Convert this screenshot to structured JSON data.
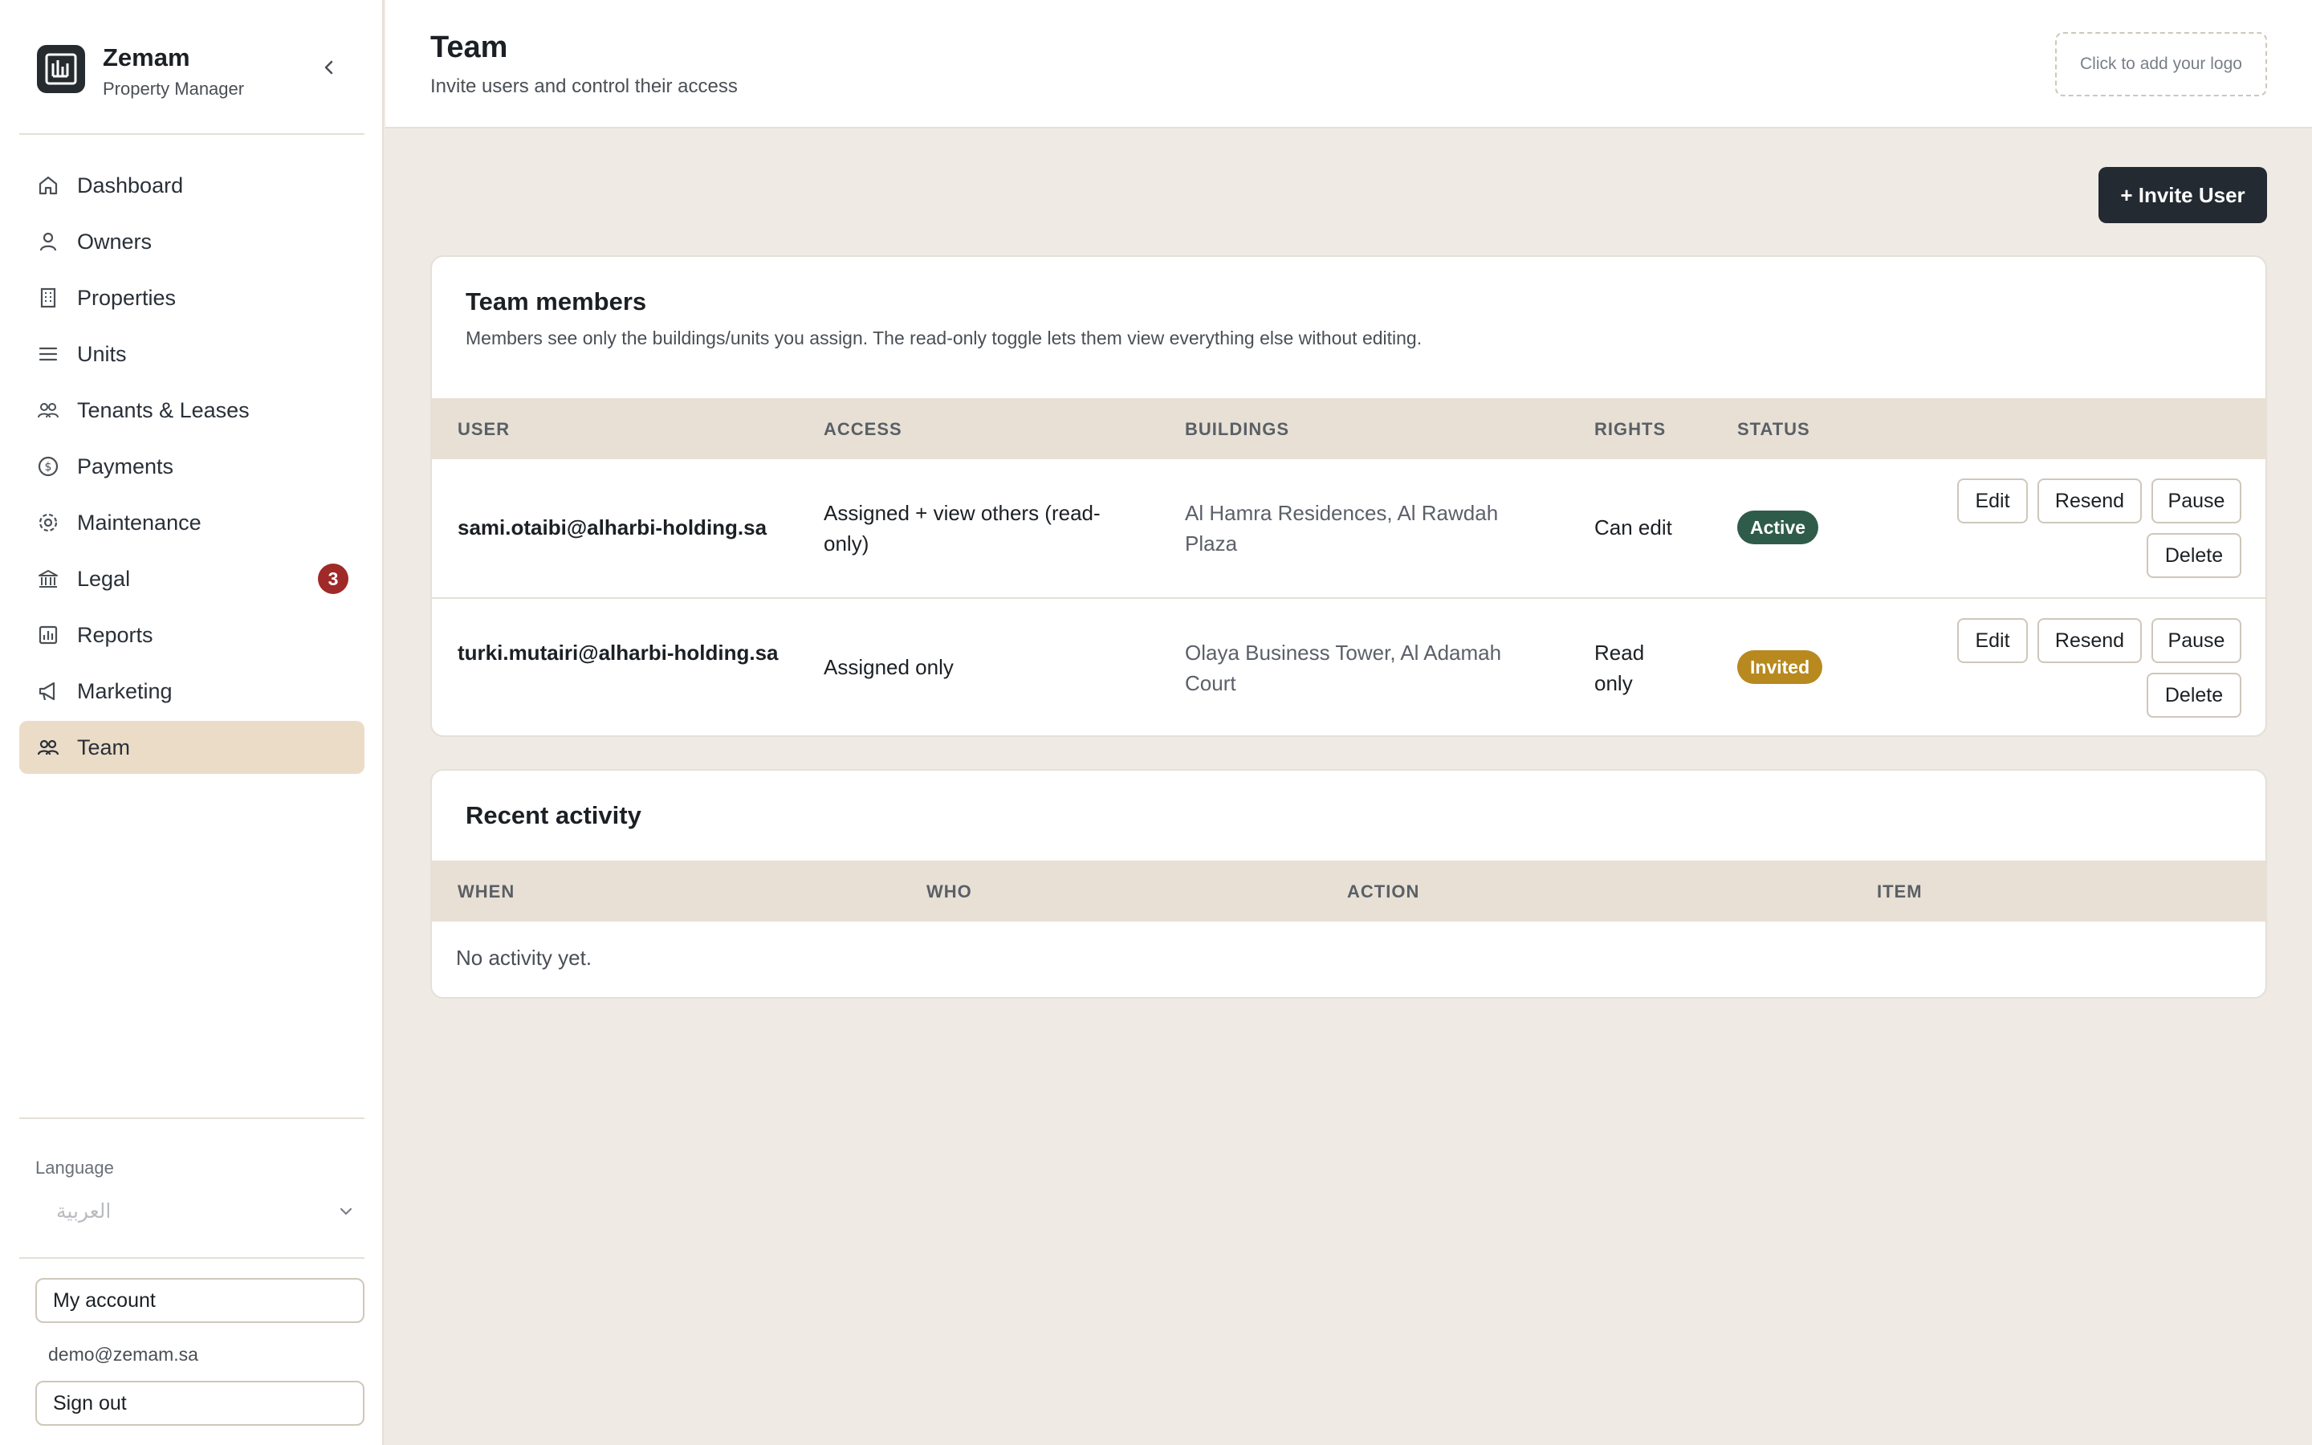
{
  "sidebar": {
    "brand": {
      "name": "Zemam",
      "subtitle": "Property Manager"
    },
    "items": [
      {
        "label": "Dashboard",
        "icon": "home-icon"
      },
      {
        "label": "Owners",
        "icon": "user-icon"
      },
      {
        "label": "Properties",
        "icon": "building-icon"
      },
      {
        "label": "Units",
        "icon": "list-icon"
      },
      {
        "label": "Tenants & Leases",
        "icon": "users-icon"
      },
      {
        "label": "Payments",
        "icon": "dollar-icon"
      },
      {
        "label": "Maintenance",
        "icon": "gear-icon"
      },
      {
        "label": "Legal",
        "icon": "bank-icon",
        "badge": "3"
      },
      {
        "label": "Reports",
        "icon": "chart-icon"
      },
      {
        "label": "Marketing",
        "icon": "megaphone-icon"
      },
      {
        "label": "Team",
        "icon": "team-icon",
        "active": true
      }
    ],
    "language": {
      "label": "Language",
      "value": "العربية"
    },
    "my_account_label": "My account",
    "email": "demo@zemam.sa",
    "sign_out_label": "Sign out"
  },
  "header": {
    "title": "Team",
    "subtitle": "Invite users and control their access",
    "logo_placeholder": "Click to add your logo"
  },
  "invite_button_label": "+ Invite User",
  "team_members": {
    "title": "Team members",
    "description": "Members see only the buildings/units you assign. The read-only toggle lets them view everything else without editing.",
    "columns": [
      "USER",
      "ACCESS",
      "BUILDINGS",
      "RIGHTS",
      "STATUS"
    ],
    "rows": [
      {
        "user": "sami.otaibi@alharbi-holding.sa",
        "access": "Assigned + view others (read-only)",
        "buildings": "Al Hamra Residences, Al Rawdah Plaza",
        "rights": "Can edit",
        "status": "Active",
        "status_color": "#2f5c4a"
      },
      {
        "user": "turki.mutairi@alharbi-holding.sa",
        "access": "Assigned only",
        "buildings": "Olaya Business Tower, Al Adamah Court",
        "rights": "Read only",
        "status": "Invited",
        "status_color": "#b8891f"
      }
    ],
    "actions": {
      "edit": "Edit",
      "resend": "Resend",
      "pause": "Pause",
      "delete": "Delete"
    }
  },
  "recent_activity": {
    "title": "Recent activity",
    "columns": [
      "WHEN",
      "WHO",
      "ACTION",
      "ITEM"
    ],
    "empty": "No activity yet."
  },
  "colors": {
    "accent_dark": "#232a31",
    "active_nav": "#ebdcc8",
    "badge": "#9f2a28",
    "background": "#efebe4"
  }
}
